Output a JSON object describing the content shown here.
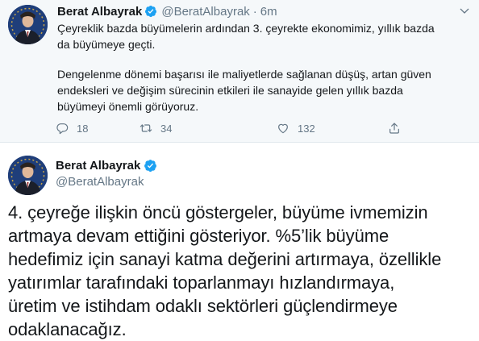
{
  "tweet_reply": {
    "author_name": "Berat Albayrak",
    "author_handle": "@BeratAlbayrak",
    "separator": "·",
    "time": "6m",
    "paragraph1": [
      "Çeyreklik bazda büyümelerin ardından 3. çeyrekte ekonomimiz, yıllık bazda",
      "da büyümeye geçti."
    ],
    "paragraph2": [
      "Dengelenme dönemi başarısı ile maliyetlerde sağlanan düşüş, artan güven",
      "endeksleri ve değişim sürecinin etkileri ile sanayide gelen yıllık bazda",
      "büyümeyi önemli görüyoruz."
    ],
    "replies": "18",
    "retweets": "34",
    "likes": "132"
  },
  "tweet_main": {
    "author_name": "Berat Albayrak",
    "author_handle": "@BeratAlbayrak",
    "lines": [
      "4. çeyreğe ilişkin öncü göstergeler, büyüme ivmemizin",
      "artmaya devam ettiğini gösteriyor. %5’lik büyüme",
      "hedefimiz için sanayi katma değerini artırmaya, özellikle",
      "yatırımlar tarafındaki toparlanmayı hızlandırmaya,",
      "üretim ve istihdam odaklı sektörleri güçlendirmeye",
      "odaklanacağız."
    ]
  },
  "colors": {
    "accent": "#1da1f2",
    "muted": "#657786",
    "text": "#14171a",
    "reply_bg": "#f5f8fa"
  },
  "icons": [
    "avatar",
    "verified-badge-icon",
    "chevron-down-icon",
    "reply-icon",
    "retweet-icon",
    "like-icon",
    "share-icon"
  ]
}
